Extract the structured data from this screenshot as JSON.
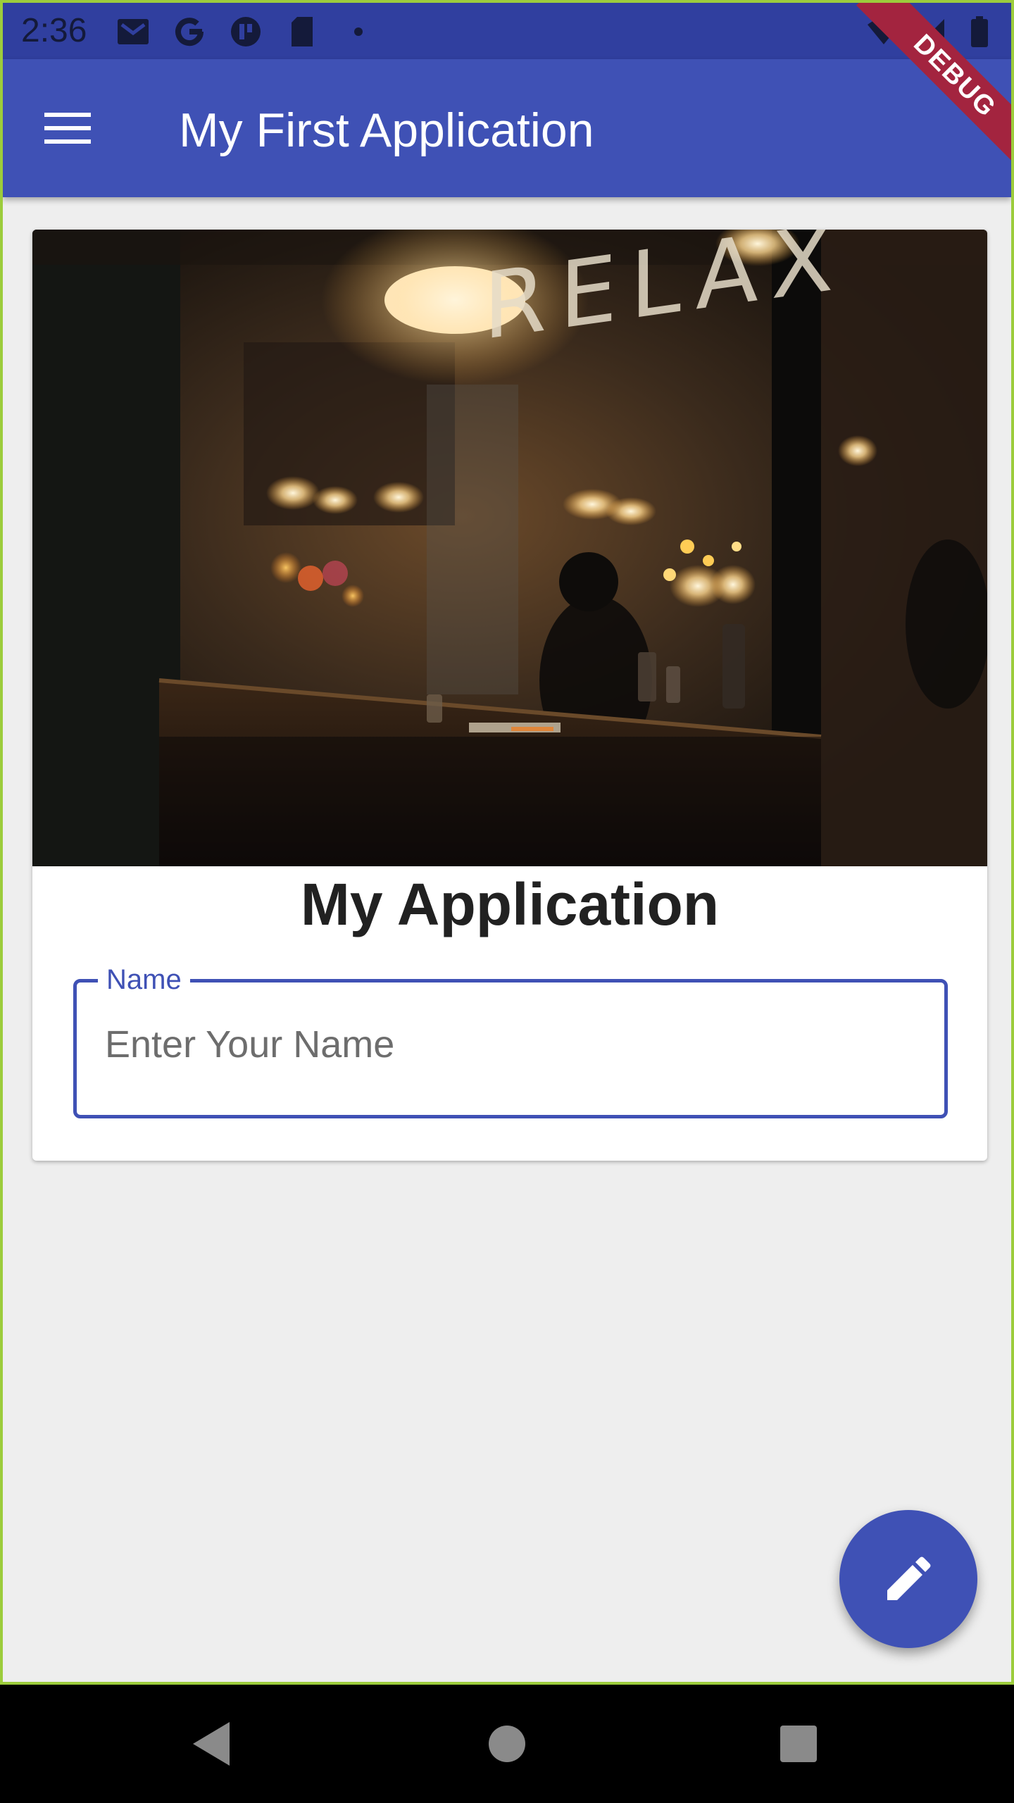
{
  "status_bar": {
    "time": "2:36",
    "icons": [
      "gmail-icon",
      "google-icon",
      "app-icon",
      "sd-card-icon",
      "dot-icon",
      "wifi-icon",
      "signal-icon",
      "battery-icon"
    ]
  },
  "app_bar": {
    "title": "My First Application",
    "menu_icon": "menu-icon"
  },
  "debug_banner": "DEBUG",
  "card": {
    "image_sign_text": "RELAX",
    "heading": "My Application",
    "name_field": {
      "label": "Name",
      "placeholder": "Enter Your Name",
      "value": ""
    }
  },
  "fab": {
    "icon": "edit-icon"
  },
  "nav_bar": {
    "buttons": [
      "back-icon",
      "home-icon",
      "recents-icon"
    ]
  },
  "colors": {
    "primary": "#3f51b5",
    "primary_dark": "#303f9f",
    "background": "#eeeeee",
    "debug_ribbon": "#a3243f"
  }
}
